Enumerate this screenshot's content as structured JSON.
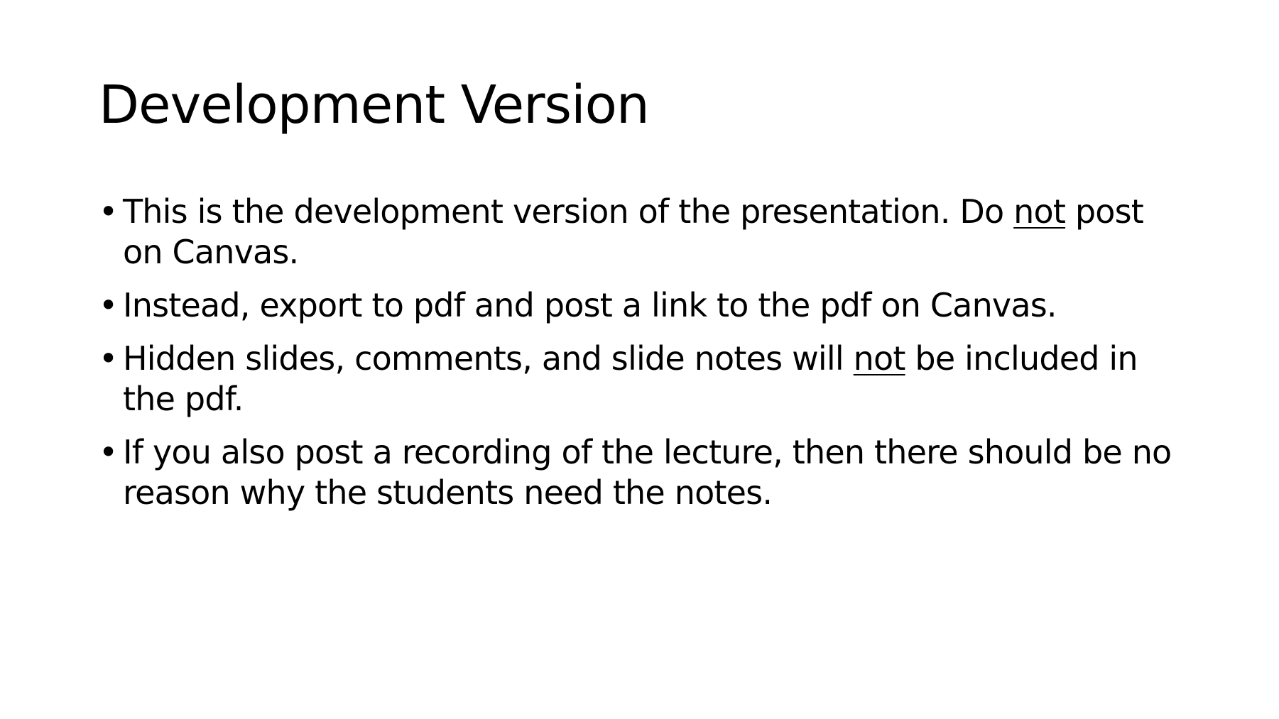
{
  "slide": {
    "title": "Development Version",
    "bullet_marker": "•",
    "bullets": [
      {
        "before": "This is the development version of the presentation. Do ",
        "emphasis": "not",
        "after": " post on Canvas."
      },
      {
        "text": "Instead, export to pdf and post a link to the pdf on Canvas."
      },
      {
        "before": "Hidden slides, comments, and slide notes will ",
        "emphasis": "not",
        "after": " be included in the pdf."
      },
      {
        "text": "If you also post a recording of the lecture, then there should be no reason why the students need the notes."
      }
    ]
  }
}
